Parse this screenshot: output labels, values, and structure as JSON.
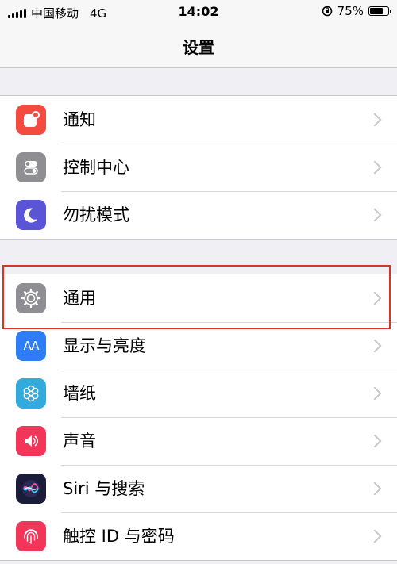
{
  "status_bar": {
    "carrier": "中国移动",
    "network": "4G",
    "time": "14:02",
    "battery": "75%",
    "battery_level": 0.75
  },
  "nav": {
    "title": "设置"
  },
  "groups": [
    {
      "items": [
        {
          "label": "通知",
          "icon": "notifications-icon",
          "color": "#f34b3f"
        },
        {
          "label": "控制中心",
          "icon": "control-center-icon",
          "color": "#8e8e93"
        },
        {
          "label": "勿扰模式",
          "icon": "moon-icon",
          "color": "#5a54d6"
        }
      ]
    },
    {
      "items": [
        {
          "label": "通用",
          "icon": "gear-icon",
          "color": "#8e8e93",
          "highlighted": true
        },
        {
          "label": "显示与亮度",
          "icon": "display-brightness-icon",
          "color": "#2e7cf6"
        },
        {
          "label": "墙纸",
          "icon": "wallpaper-icon",
          "color": "#33aadc"
        },
        {
          "label": "声音",
          "icon": "speaker-icon",
          "color": "#f2365a"
        },
        {
          "label": "Siri 与搜索",
          "icon": "siri-icon",
          "color": "#1b1b3a"
        },
        {
          "label": "触控 ID 与密码",
          "icon": "fingerprint-icon",
          "color": "#f2365a"
        }
      ]
    }
  ],
  "display_icon_text": "AA",
  "colors": {
    "highlight": "#d9342b",
    "background": "#efeff4"
  }
}
